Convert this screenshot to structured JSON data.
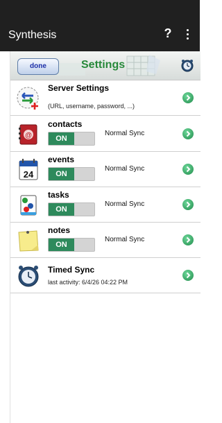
{
  "app": {
    "title": "Synthesis",
    "help_label": "?"
  },
  "header": {
    "done_label": "done",
    "title": "Settings"
  },
  "server": {
    "title": "Server Settings",
    "subtitle": "(URL, username, password, ...)"
  },
  "sync_items": [
    {
      "name": "contacts",
      "toggle": "ON",
      "mode": "Normal Sync"
    },
    {
      "name": "events",
      "toggle": "ON",
      "mode": "Normal Sync",
      "calendar_day": "24"
    },
    {
      "name": "tasks",
      "toggle": "ON",
      "mode": "Normal Sync"
    },
    {
      "name": "notes",
      "toggle": "ON",
      "mode": "Normal Sync"
    }
  ],
  "timed_sync": {
    "title": "Timed Sync",
    "last_activity": "last activity:  6/4/26  04:22 PM"
  },
  "colors": {
    "accent_green": "#27893a",
    "toggle_on": "#2e8a5c",
    "bar": "#202020"
  },
  "icons": [
    "server-settings-icon",
    "contacts-icon",
    "calendar-icon",
    "tasks-icon",
    "notes-icon",
    "alarm-clock-icon",
    "chevron-right-icon",
    "more-vert-icon",
    "help-icon"
  ]
}
